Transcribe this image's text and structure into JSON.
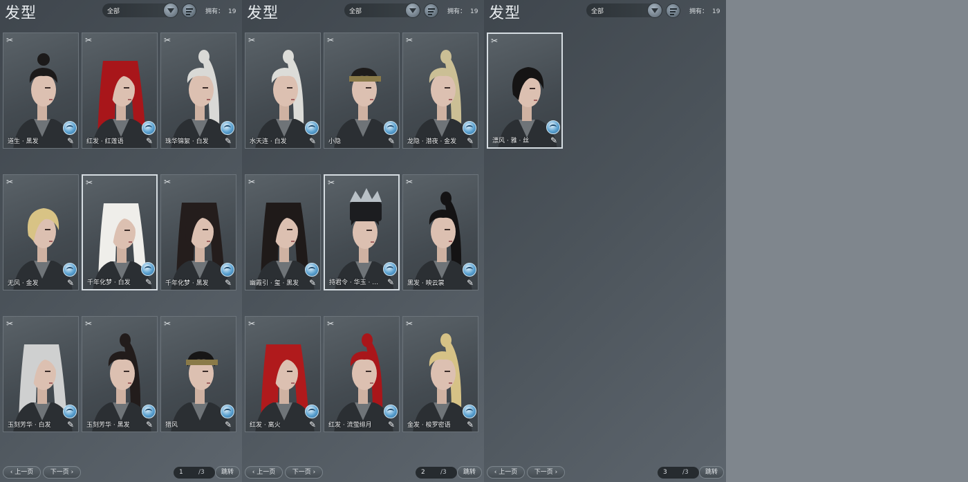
{
  "colors": {
    "panel_bg": "#454c52",
    "selected_border": "#d6dde2",
    "dye_button": "#5aa1d0"
  },
  "panels": [
    {
      "title": "发型",
      "filter": "全部",
      "owned_label": "拥有：",
      "owned_count": "19",
      "cards": [
        {
          "label": "道生 · 黑发",
          "hair": "#1c1a1a",
          "style": "bun",
          "selected": false
        },
        {
          "label": "红发 · 红莲语",
          "hair": "#a8161a",
          "style": "long",
          "selected": false
        },
        {
          "label": "珠华锦絮 · 白发",
          "hair": "#d9d9d6",
          "style": "pony",
          "selected": false
        },
        {
          "label": "无风 · 金发",
          "hair": "#d8c385",
          "style": "short",
          "selected": false
        },
        {
          "label": "千年化梦 · 白发",
          "hair": "#efeeea",
          "style": "long",
          "selected": true
        },
        {
          "label": "千年化梦 · 黑发",
          "hair": "#241d1c",
          "style": "long",
          "selected": false
        },
        {
          "label": "玉刻芳华 · 白发",
          "hair": "#cfd0d0",
          "style": "long",
          "selected": false
        },
        {
          "label": "玉刻芳华 · 黑发",
          "hair": "#221c1b",
          "style": "pony",
          "selected": false
        },
        {
          "label": "猎风",
          "hair": "#171616",
          "style": "band",
          "selected": false
        }
      ],
      "page": "1",
      "total": "/3",
      "prev": "上一页",
      "next": "下一页",
      "jump": "跳转"
    },
    {
      "title": "发型",
      "filter": "全部",
      "owned_label": "拥有：",
      "owned_count": "19",
      "cards": [
        {
          "label": "水天连 · 白发",
          "hair": "#dcdcd8",
          "style": "pony",
          "selected": false
        },
        {
          "label": "小隐",
          "hair": "#1e1c1b",
          "style": "band",
          "selected": false
        },
        {
          "label": "龙隐 · 潜夜 · 金发",
          "hair": "#cbbf95",
          "style": "pony",
          "selected": false
        },
        {
          "label": "幽霞引 · 玺 · 黑发",
          "hair": "#1f1a19",
          "style": "long",
          "selected": false
        },
        {
          "label": "持君令 · 华玉 · …",
          "hair": "#1a1a1c",
          "style": "crown",
          "selected": true
        },
        {
          "label": "黑发 · 映云裳",
          "hair": "#141314",
          "style": "pony",
          "selected": false
        },
        {
          "label": "红发 · 离火",
          "hair": "#b01a1c",
          "style": "long",
          "selected": false
        },
        {
          "label": "红发 · 流萤绯月",
          "hair": "#a9161a",
          "style": "pony",
          "selected": false
        },
        {
          "label": "金发 · 梭罗密语",
          "hair": "#d6c286",
          "style": "pony",
          "selected": false
        }
      ],
      "page": "2",
      "total": "/3",
      "prev": "上一页",
      "next": "下一页",
      "jump": "跳转"
    },
    {
      "title": "发型",
      "filter": "全部",
      "owned_label": "拥有：",
      "owned_count": "19",
      "cards": [
        {
          "label": "漂风 · 雅 · 丝",
          "hair": "#151414",
          "style": "short",
          "selected": true
        }
      ],
      "page": "3",
      "total": "/3",
      "prev": "上一页",
      "next": "下一页",
      "jump": "跳转"
    }
  ]
}
